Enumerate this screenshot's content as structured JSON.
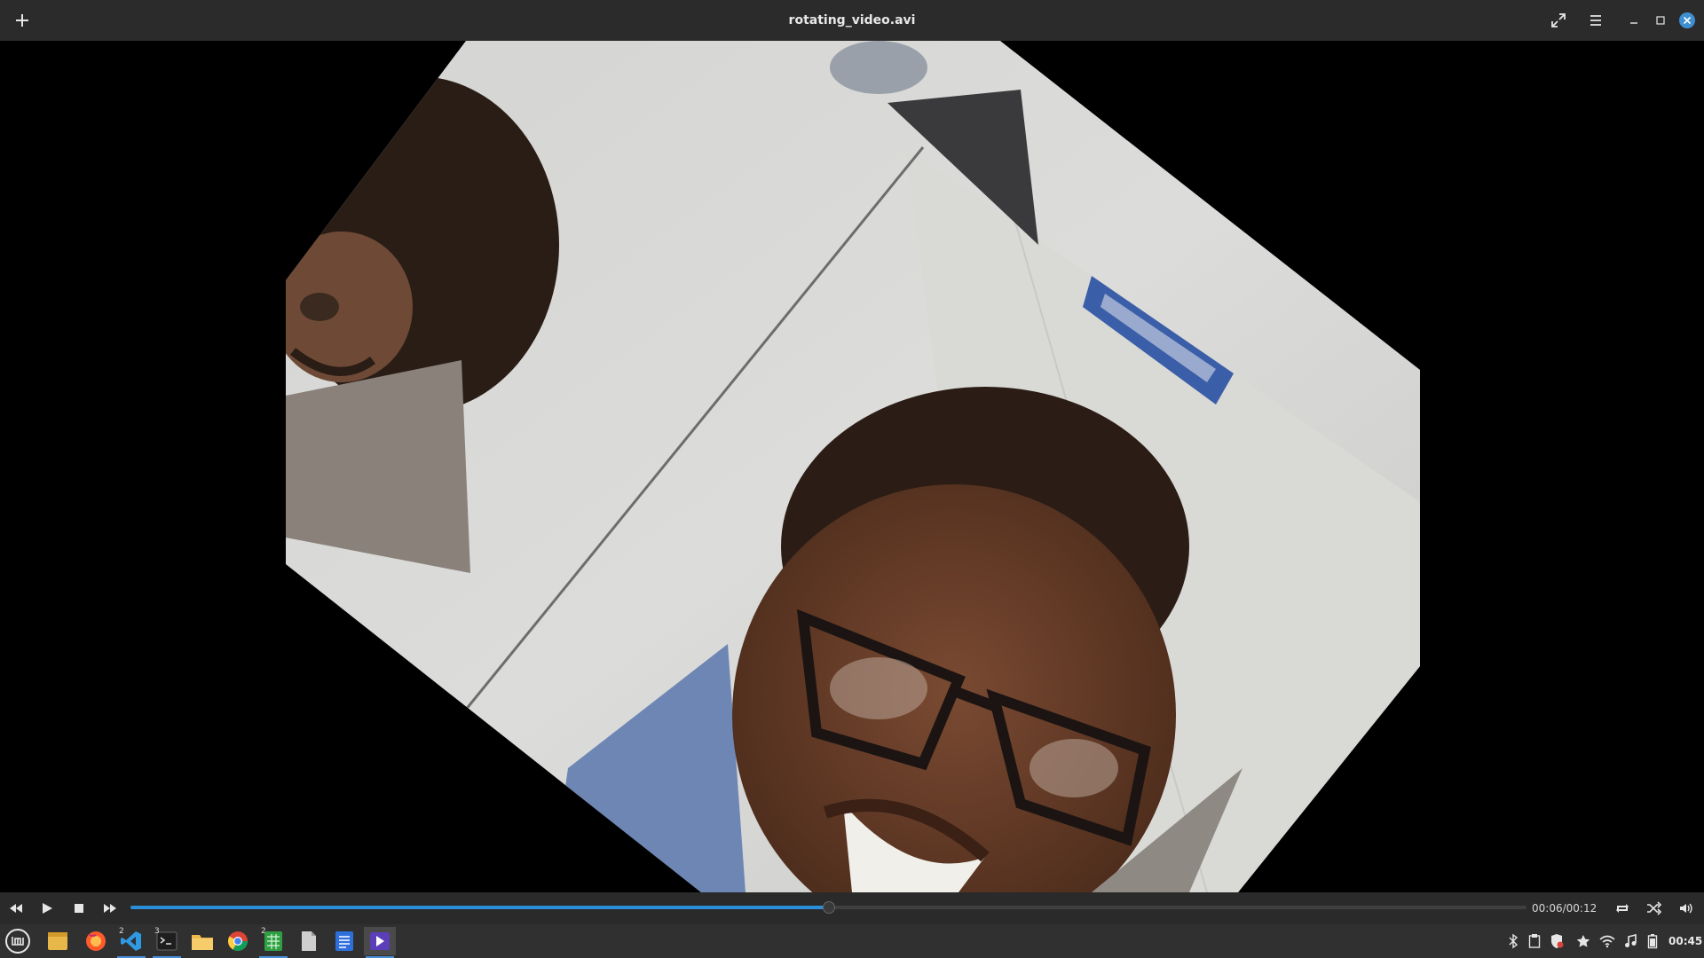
{
  "window": {
    "title": "rotating_video.avi"
  },
  "player": {
    "time_display": "00:06/00:12",
    "progress_fraction": 0.5
  },
  "taskbar": {
    "badges": {
      "vscode": "2",
      "terminal": "3",
      "spreadsheet": "2"
    },
    "clock": "00:45"
  },
  "colors": {
    "accent": "#2a8fd8",
    "titlebar_bg": "#2b2b2b",
    "taskbar_bg": "#303030",
    "close_button": "#3d8fd1"
  }
}
